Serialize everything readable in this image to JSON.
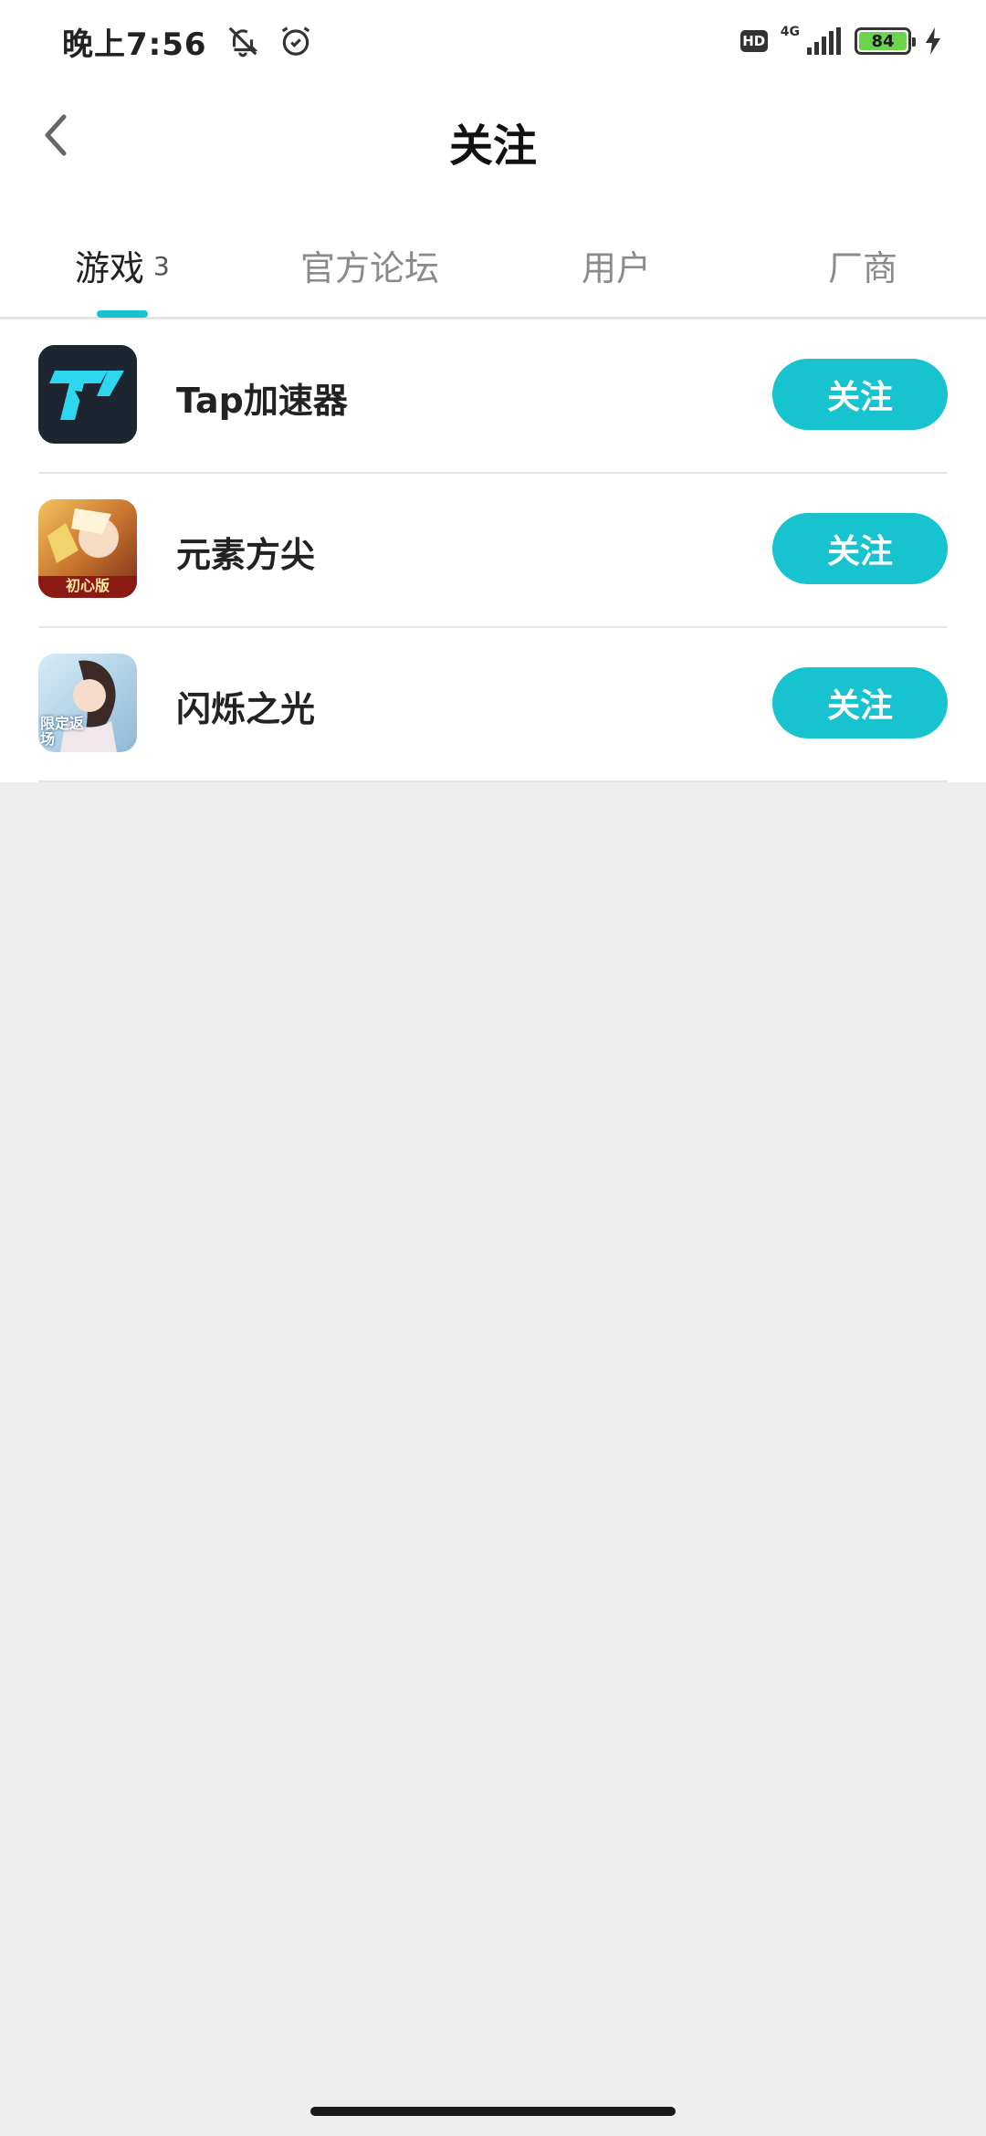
{
  "status_bar": {
    "time": "晚上7:56",
    "network": "4G",
    "hd": "HD",
    "battery": "84",
    "icons": [
      "bell-off-icon",
      "alarm-icon",
      "signal-icon",
      "charging-icon"
    ]
  },
  "header": {
    "title": "关注"
  },
  "tabs": [
    {
      "label": "游戏",
      "count": "3",
      "active": true
    },
    {
      "label": "官方论坛",
      "active": false
    },
    {
      "label": "用户",
      "active": false
    },
    {
      "label": "厂商",
      "active": false
    }
  ],
  "games": [
    {
      "name": "Tap加速器",
      "button": "关注",
      "icon": "tap-accelerator-icon"
    },
    {
      "name": "元素方尖",
      "button": "关注",
      "icon": "element-obelisk-icon",
      "icon_badge": "初心版"
    },
    {
      "name": "闪烁之光",
      "button": "关注",
      "icon": "flicker-light-icon",
      "icon_badge": "限定返场"
    }
  ],
  "colors": {
    "accent": "#16c3cf",
    "background": "#eeeeee",
    "battery": "#6ad44a"
  }
}
